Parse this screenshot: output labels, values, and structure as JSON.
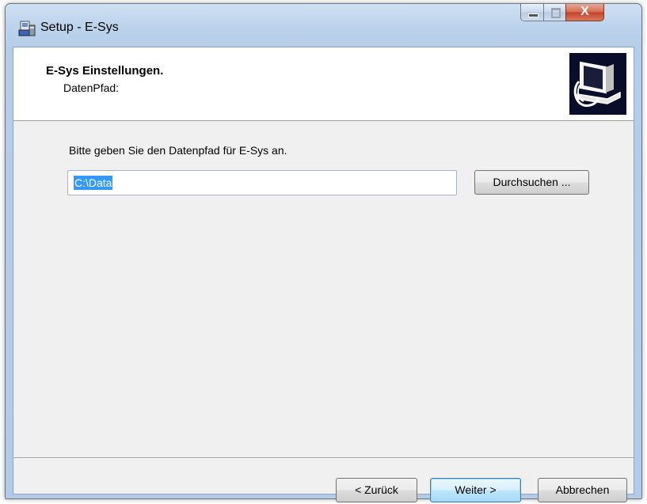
{
  "window": {
    "title": "Setup - E-Sys",
    "app_icon": "installer-icon",
    "controls": {
      "minimize_icon": "minimize-icon",
      "maximize_icon": "maximize-icon",
      "close_icon": "close-icon",
      "close_glyph": "X"
    }
  },
  "header": {
    "title": "E-Sys Einstellungen.",
    "subtitle": "DatenPfad:",
    "logo_icon": "computer-setup-icon"
  },
  "main": {
    "prompt": "Bitte geben Sie den Datenpfad für E-Sys an.",
    "path_value": "C:\\Data",
    "browse_label": "Durchsuchen ..."
  },
  "footer": {
    "back_label": "< Zurück",
    "next_label": "Weiter >",
    "cancel_label": "Abbrechen"
  },
  "colors": {
    "selection": "#3399ff",
    "default_button_border": "#3c7fb1",
    "close_button": "#c4432a",
    "logo_background": "#0a0d2a"
  }
}
